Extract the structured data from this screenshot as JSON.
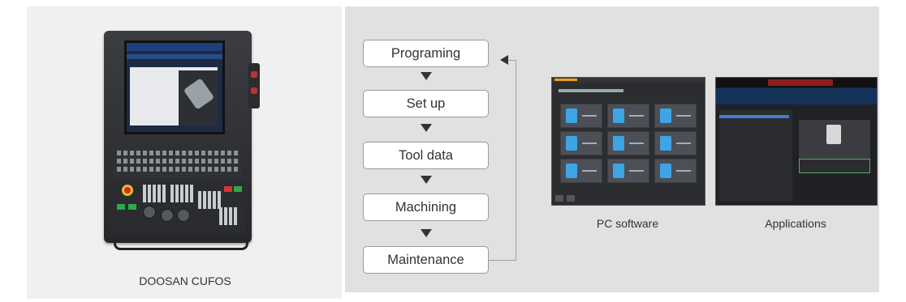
{
  "device": {
    "caption": "DOOSAN CUFOS"
  },
  "flow": {
    "steps": [
      "Programing",
      "Set up",
      "Tool data",
      "Machining",
      "Maintenance"
    ]
  },
  "screenshots": {
    "pc_software_caption": "PC software",
    "applications_caption": "Applications"
  },
  "colors": {
    "left_panel_bg": "#f0f0f0",
    "right_panel_bg": "#e1e1e1",
    "step_border": "#9a9a9a",
    "arrow": "#333333",
    "loop_line": "#a0a0a0"
  }
}
